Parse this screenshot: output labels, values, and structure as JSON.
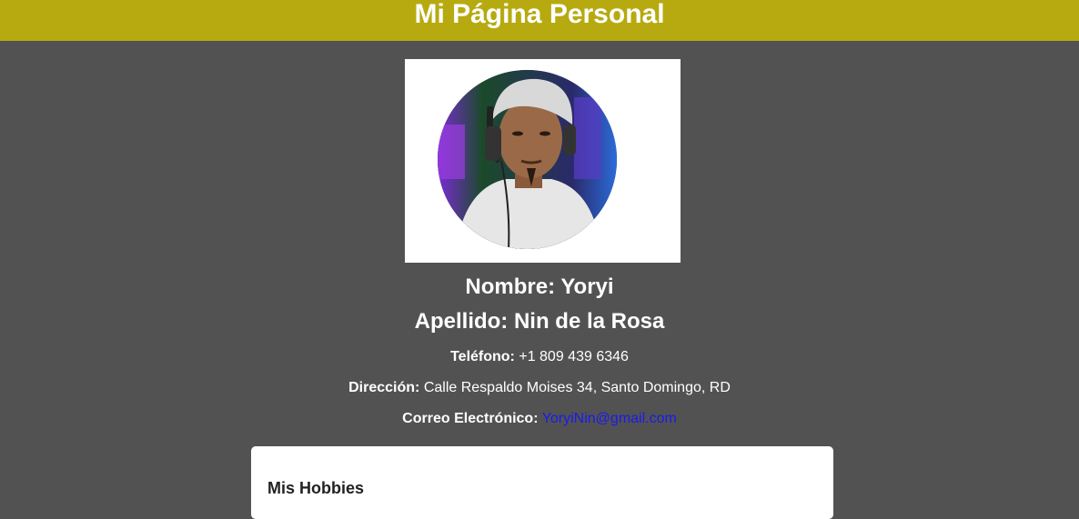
{
  "header": {
    "title": "Mi Página Personal"
  },
  "profile": {
    "name": "Nombre: Yoryi",
    "surname": "Apellido: Nin de la Rosa",
    "phone_label": "Teléfono:",
    "phone_value": "+1 809 439 6346",
    "address_label": "Dirección:",
    "address_value": "Calle Respaldo Moises 34, Santo Domingo, RD",
    "email_label": "Correo Electrónico:",
    "email_value": "YoryiNin@gmail.com"
  },
  "hobbies": {
    "title": "Mis Hobbies"
  },
  "colors": {
    "header_bg": "#b6aa10",
    "page_bg": "#525252",
    "link": "#1a1aee"
  }
}
